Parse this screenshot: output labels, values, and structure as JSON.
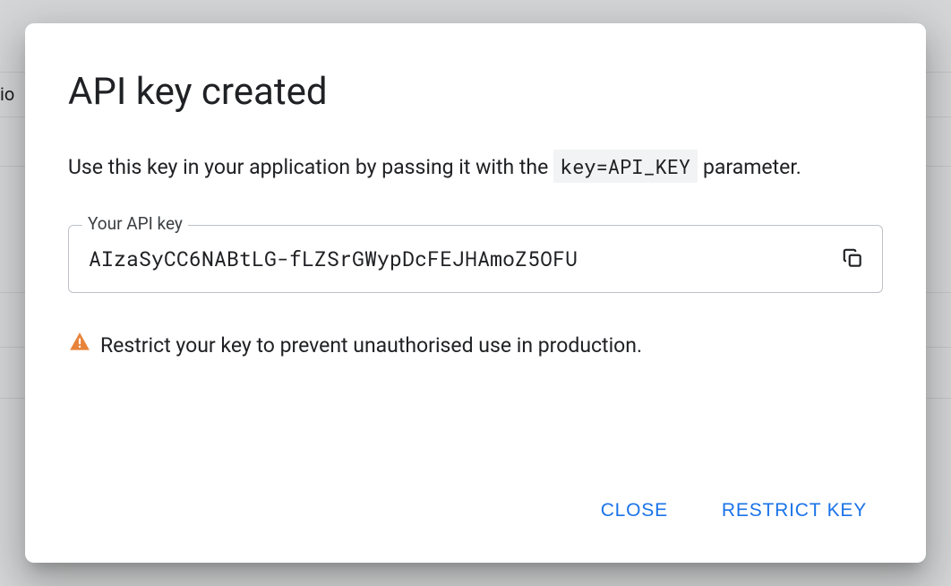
{
  "dialog": {
    "title": "API key created",
    "description_before": "Use this key in your application by passing it with the ",
    "description_code": "key=API_KEY",
    "description_after": " parameter.",
    "field_label": "Your API key",
    "api_key_value": "AIzaSyCC6NABtLG-fLZSrGWypDcFEJHAmoZ5OFU",
    "warning_text": "Restrict your key to prevent unauthorised use in production."
  },
  "actions": {
    "close_label": "CLOSE",
    "restrict_label": "RESTRICT KEY"
  },
  "backdrop_fragment": "io"
}
